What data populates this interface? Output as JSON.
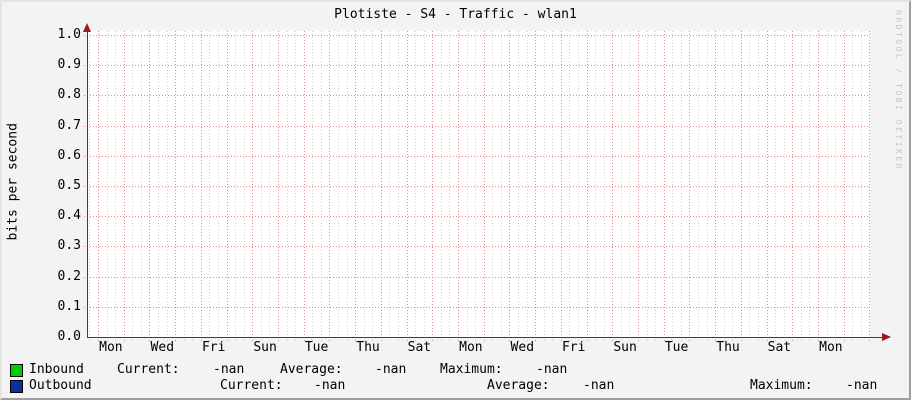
{
  "chart_data": {
    "type": "line",
    "title": "Plotiste - S4 - Traffic - wlan1",
    "ylabel": "bits per second",
    "xlabel": "",
    "ylim": [
      0.0,
      1.0
    ],
    "y_tick_labels": [
      "1.0",
      "0.9",
      "0.8",
      "0.7",
      "0.6",
      "0.5",
      "0.4",
      "0.3",
      "0.2",
      "0.1",
      "0.0"
    ],
    "x_tick_labels": [
      "Mon",
      "Wed",
      "Fri",
      "Sun",
      "Tue",
      "Thu",
      "Sat",
      "Mon",
      "Wed",
      "Fri",
      "Sun",
      "Tue",
      "Thu",
      "Sat",
      "Mon"
    ],
    "grid": true,
    "legend_position": "bottom-left",
    "series": [
      {
        "name": "Inbound",
        "color": "#00cc00",
        "values": []
      },
      {
        "name": "Outbound",
        "color": "#0a2ea4",
        "values": []
      }
    ]
  },
  "watermark": "RRDTOOL / TOBI OETIKER",
  "legend": {
    "stat_labels": {
      "current": "Current:",
      "average": "Average:",
      "maximum": "Maximum:"
    },
    "rows": [
      {
        "label": "Inbound",
        "color": "#00cc00",
        "current": "-nan",
        "average": "-nan",
        "maximum": "-nan"
      },
      {
        "label": "Outbound",
        "color": "#0a2ea4",
        "current": "-nan",
        "average": "-nan",
        "maximum": "-nan"
      }
    ]
  },
  "colors": {
    "background": "#f3f3f3",
    "canvas": "#ffffff",
    "axis": "#3f3f3f",
    "arrow": "#9b1c1c",
    "grid_major": "#e05252",
    "grid_minor": "#a5a5a5"
  }
}
